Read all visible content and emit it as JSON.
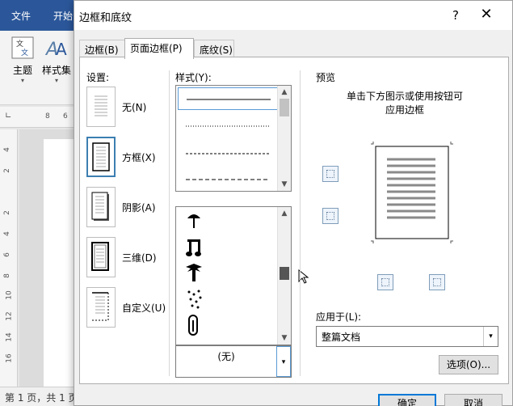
{
  "word": {
    "tab_file": "文件",
    "tab_home": "开始",
    "ribbon_theme": "主题",
    "ribbon_styleset": "样式集",
    "status_page": "第 1 页，共 1 页",
    "ruler_h": [
      "8",
      "6"
    ],
    "ruler_v": [
      "4",
      "2",
      "2",
      "4",
      "6",
      "8",
      "10",
      "12",
      "14",
      "16"
    ]
  },
  "dialog": {
    "title": "边框和底纹",
    "help": "?",
    "close": "✕",
    "tabs": [
      "边框(B)",
      "页面边框(P)",
      "底纹(S)"
    ],
    "settings_label": "设置:",
    "settings": [
      "无(N)",
      "方框(X)",
      "阴影(A)",
      "三维(D)",
      "自定义(U)"
    ],
    "style_label": "样式(Y):",
    "art_value": "(无)",
    "preview_label": "预览",
    "preview_hint_1": "单击下方图示或使用按钮可",
    "preview_hint_2": "应用边框",
    "apply_label": "应用于(L):",
    "apply_value": "整篇文档",
    "options_button": "选项(O)...",
    "ok_button": "确定",
    "cancel_button": "取消"
  },
  "colors": {
    "word_blue": "#2b579a",
    "selection_blue": "#3c7fb1",
    "primary_border": "#0078d7"
  }
}
